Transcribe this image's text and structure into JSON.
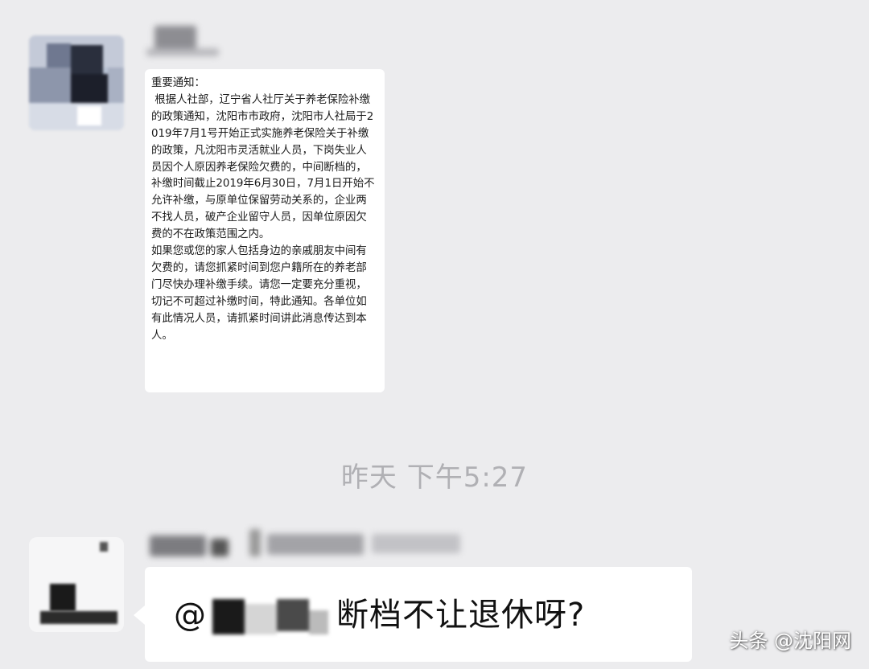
{
  "messages": [
    {
      "text": "重要通知：\n 根据人社部，辽宁省人社厅关于养老保险补缴的政策通知，沈阳市市政府，沈阳市人社局于2019年7月1号开始正式实施养老保险关于补缴的政策，凡沈阳市灵活就业人员，下岗失业人员因个人原因养老保险欠费的，中间断档的，补缴时间截止2019年6月30日，7月1日开始不允许补缴，与原单位保留劳动关系的，企业两不找人员，破产企业留守人员，因单位原因欠费的不在政策范围之内。\n如果您或您的家人包括身边的亲戚朋友中间有欠费的，请您抓紧时间到您户籍所在的养老部门尽快办理补缴手续。请您一定要充分重视，切记不可超过补缴时间，特此通知。各单位如有此情况人员，请抓紧时间讲此消息传达到本人。"
    },
    {
      "mention_prefix": "@",
      "text": "断档不让退休呀?"
    }
  ],
  "timestamp": "昨天 下午5:27",
  "watermark": "头条 @沈阳网"
}
